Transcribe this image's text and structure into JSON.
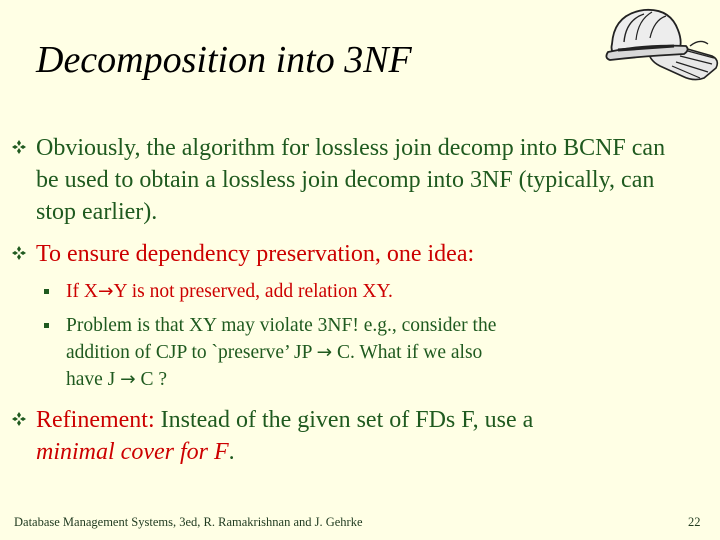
{
  "slide": {
    "title": "Decomposition into 3NF",
    "bullets": [
      {
        "text": "Obviously, the algorithm for lossless join decomp into BCNF can be used to obtain a lossless join decomp into 3NF (typically, can stop earlier)."
      },
      {
        "text": "To ensure dependency preservation, one idea:",
        "sub": [
          {
            "pre": "If  X",
            "arrow": "→",
            "post": "Y  is not preserved,  add relation XY."
          },
          {
            "line1": "Problem is that XY may violate 3NF!  e.g.,  consider the",
            "line2_pre": "addition of CJP to `preserve’  JP ",
            "arrow": "→",
            "line2_post": "  C.   What if we also",
            "line3_pre": "have  J ",
            "line3_post": "   C ?"
          }
        ]
      },
      {
        "label": "Refinement:",
        "text_a": "  Instead of the given set of FDs F, use a",
        "text_b": "minimal cover for F",
        "text_c": "."
      }
    ]
  },
  "footer": {
    "text": "Database Management Systems, 3ed, R. Ramakrishnan and J. Gehrke",
    "page_number": "22"
  },
  "icons": {
    "bullet_marker": "four-diamond-bullet-icon",
    "logo": "hardhat-gloves-logo"
  },
  "colors": {
    "background": "#FFFFE5",
    "green_text": "#1F5A1F",
    "red_text": "#CC0000",
    "bullet_marker": "#1F5A1F"
  }
}
